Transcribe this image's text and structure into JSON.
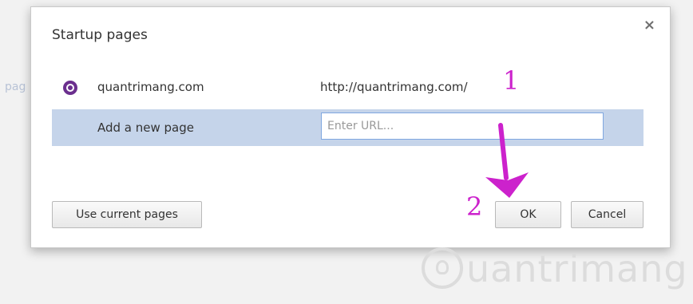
{
  "background": {
    "fragment_text": "pag"
  },
  "dialog": {
    "title": "Startup pages",
    "close_label": "×",
    "pages": [
      {
        "name": "quantrimang.com",
        "url": "http://quantrimang.com/",
        "icon": "site-favicon-icon"
      }
    ],
    "add_page": {
      "label": "Add a new page",
      "url_placeholder": "Enter URL...",
      "url_value": ""
    },
    "buttons": {
      "use_current": "Use current pages",
      "ok": "OK",
      "cancel": "Cancel"
    }
  },
  "annotations": {
    "step1": "1",
    "step2": "2",
    "color": "#cc22cc"
  },
  "watermark": {
    "text": "uantrimang",
    "icon": "lightbulb-icon"
  },
  "colors": {
    "row_highlight": "#c5d4ea",
    "input_border": "#7fa7e0",
    "favicon": "#6b2f8e"
  }
}
